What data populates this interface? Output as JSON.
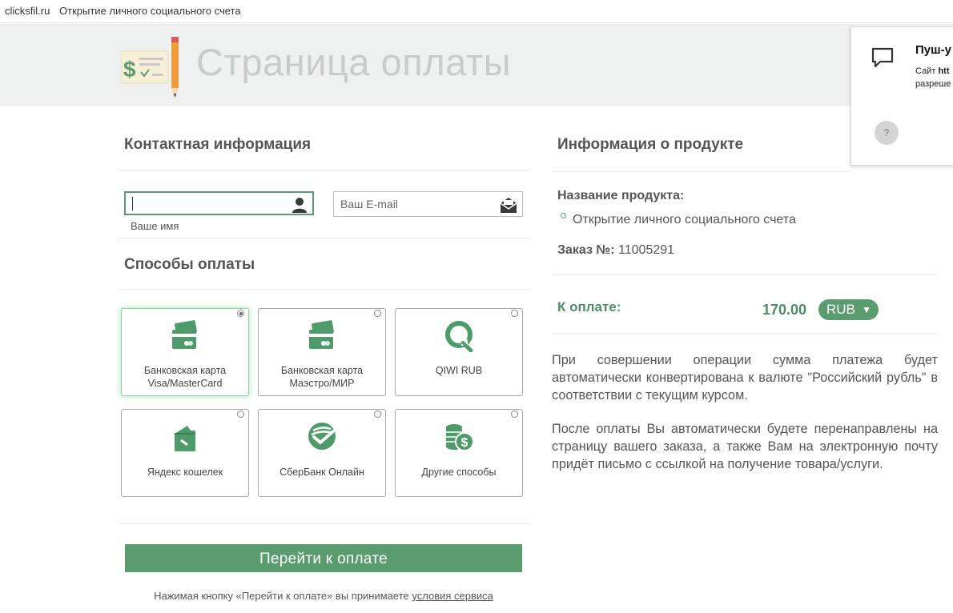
{
  "topbar": {
    "site": "clicksfil.ru",
    "title": "Открытие личного социального счета"
  },
  "header": {
    "page_title": "Страница оплаты",
    "logo_icon": "receipt-pencil-icon"
  },
  "push": {
    "title": "Пуш-у",
    "line1_prefix": "Сайт ",
    "line1_bold": "htt",
    "line2": "разреше",
    "help": "?"
  },
  "contact": {
    "heading": "Контактная информация",
    "name_placeholder": "",
    "name_value": "",
    "name_hint": "Ваше имя",
    "email_placeholder": "Ваш E-mail"
  },
  "payment": {
    "heading": "Способы оплаты",
    "methods": [
      {
        "label1": "Банковская карта",
        "label2": "Visa/MasterCard",
        "icon": "bank-card-icon",
        "selected": true
      },
      {
        "label1": "Банковская карта",
        "label2": "Маэстро/МИР",
        "icon": "bank-card-icon",
        "selected": false
      },
      {
        "label1": "QIWI RUB",
        "label2": "",
        "icon": "qiwi-icon",
        "selected": false
      },
      {
        "label1": "Яндекс кошелек",
        "label2": "",
        "icon": "wallet-icon",
        "selected": false
      },
      {
        "label1": "СберБанк Онлайн",
        "label2": "",
        "icon": "sberbank-icon",
        "selected": false
      },
      {
        "label1": "Другие способы",
        "label2": "",
        "icon": "coins-icon",
        "selected": false
      }
    ],
    "button": "Перейти к оплате",
    "terms_prefix": "Нажимая кнопку «Перейти к оплате» вы принимаете ",
    "terms_link": "условия сервиса"
  },
  "product": {
    "heading": "Информация о продукте",
    "name_label": "Название продукта:",
    "name_value": "Открытие личного социального счета",
    "order_label": "Заказ №:",
    "order_value": "11005291",
    "topay_label": "К оплате:",
    "amount": "170.00",
    "currency": "RUB",
    "note1": "При совершении операции сумма платежа будет автоматически конвертирована к валюте \"Российский рубль\" в соответствии с текущим курсом.",
    "note2": "После оплаты Вы автоматически будете перенаправлены на страницу вашего заказа, а также Вам на электронную почту придёт письмо с ссылкой на получение товара/услуги."
  },
  "colors": {
    "accent": "#5a9c6e",
    "header_bg": "#eef1f0",
    "title_gray": "#c6cdca"
  }
}
